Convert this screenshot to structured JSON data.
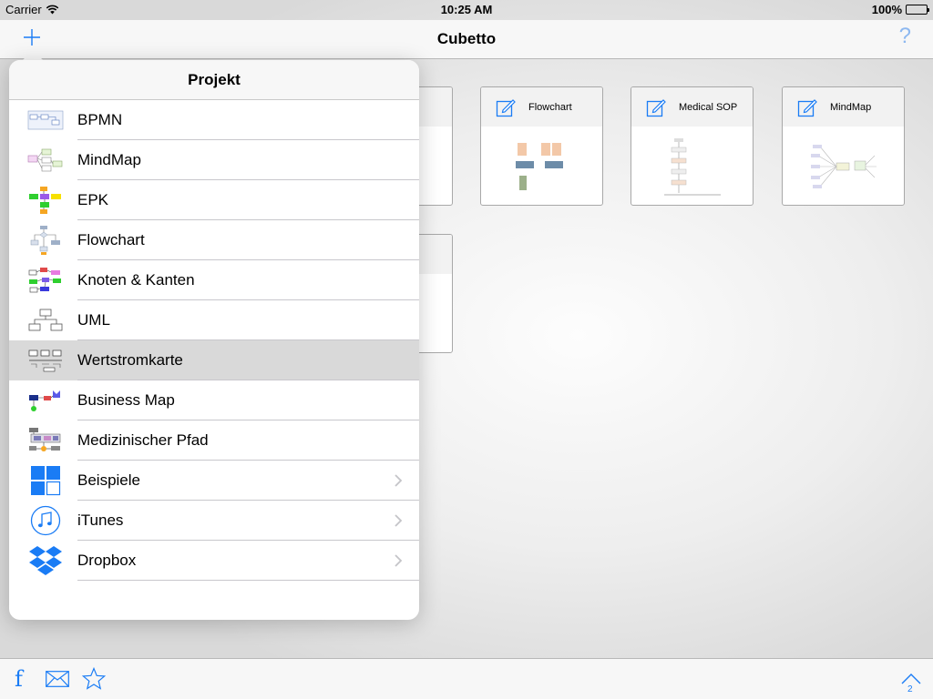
{
  "status_bar": {
    "carrier": "Carrier",
    "time": "10:25 AM",
    "battery": "100%"
  },
  "nav": {
    "title": "Cubetto",
    "help": "?"
  },
  "cards": [
    {
      "title": "Flowchart"
    },
    {
      "title": "Medical SOP"
    },
    {
      "title": "MindMap"
    }
  ],
  "popover": {
    "title": "Projekt",
    "items": [
      {
        "label": "BPMN",
        "icon": "bpmn-icon"
      },
      {
        "label": "MindMap",
        "icon": "mindmap-icon"
      },
      {
        "label": "EPK",
        "icon": "epk-icon"
      },
      {
        "label": "Flowchart",
        "icon": "flowchart-icon"
      },
      {
        "label": "Knoten & Kanten",
        "icon": "nodes-edges-icon"
      },
      {
        "label": "UML",
        "icon": "uml-icon"
      },
      {
        "label": "Wertstromkarte",
        "icon": "value-stream-icon",
        "selected": true
      },
      {
        "label": "Business Map",
        "icon": "business-map-icon"
      },
      {
        "label": "Medizinischer Pfad",
        "icon": "medical-path-icon"
      },
      {
        "label": "Beispiele",
        "icon": "examples-icon",
        "disclosure": true
      },
      {
        "label": "iTunes",
        "icon": "itunes-icon",
        "disclosure": true
      },
      {
        "label": "Dropbox",
        "icon": "dropbox-icon",
        "disclosure": true
      }
    ]
  },
  "toolbar": {
    "facebook": "f",
    "page_count": "2"
  },
  "colors": {
    "accent": "#1a7cf5",
    "selected_row": "#d9d9d9"
  }
}
